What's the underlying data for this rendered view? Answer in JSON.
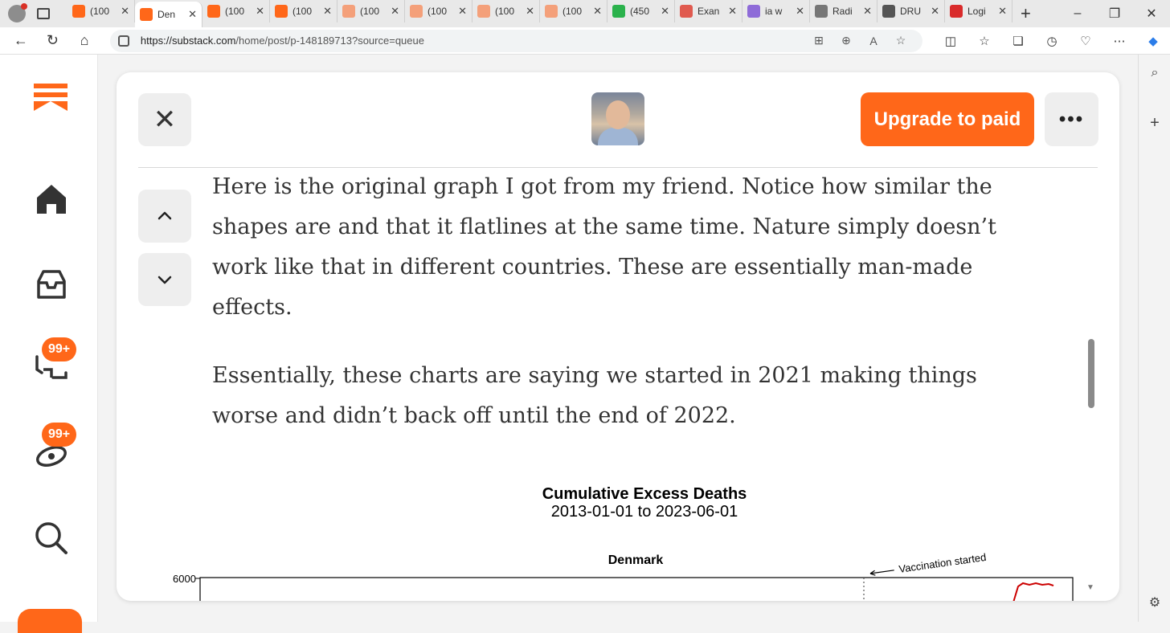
{
  "browser": {
    "tabs": [
      {
        "title": "(100",
        "favicon_color": "#ff6719",
        "active": false
      },
      {
        "title": "Den",
        "favicon_color": "#ff6719",
        "active": true
      },
      {
        "title": "(100",
        "favicon_color": "#ff6719",
        "active": false
      },
      {
        "title": "(100",
        "favicon_color": "#ff6719",
        "active": false
      },
      {
        "title": "(100",
        "favicon_color": "#f4a07a",
        "active": false
      },
      {
        "title": "(100",
        "favicon_color": "#f4a07a",
        "active": false
      },
      {
        "title": "(100",
        "favicon_color": "#f4a07a",
        "active": false
      },
      {
        "title": "(100",
        "favicon_color": "#f4a07a",
        "active": false
      },
      {
        "title": "(450",
        "favicon_color": "#2bb24c",
        "active": false
      },
      {
        "title": "Exan",
        "favicon_color": "#e05a4f",
        "active": false
      },
      {
        "title": "ia w",
        "favicon_color": "#8e6bd8",
        "active": false
      },
      {
        "title": "Radi",
        "favicon_color": "#777777",
        "active": false
      },
      {
        "title": "DRU",
        "favicon_color": "#555555",
        "active": false
      },
      {
        "title": "Logi",
        "favicon_color": "#d92b2b",
        "active": false
      }
    ],
    "url_domain": "https://substack.com",
    "url_path": "/home/post/p-148189713?source=queue"
  },
  "sidebar": {
    "badges": [
      "99+",
      "99+"
    ]
  },
  "reader": {
    "upgrade_label": "Upgrade to paid",
    "more_label": "•••",
    "close_label": "✕",
    "up_label": "⌃",
    "down_label": "⌄",
    "paragraph_1": "Here is the original graph I got from my friend. Notice how similar the shapes are and that it flatlines at the same time. Nature simply doesn’t work like that in different countries. These are essentially man-made effects.",
    "paragraph_2": "Essentially, these charts are saying we started in 2021 making things worse and didn’t back off until the end of 2022."
  },
  "chart_data": {
    "type": "line",
    "title": "Cumulative Excess Deaths",
    "subtitle": "2013-01-01 to 2023-06-01",
    "panel_title": "Denmark",
    "annotation": "Vaccination started",
    "y_ticks": [
      "6000"
    ],
    "series_color": "#cc0000"
  },
  "colors": {
    "accent": "#ff6719"
  }
}
